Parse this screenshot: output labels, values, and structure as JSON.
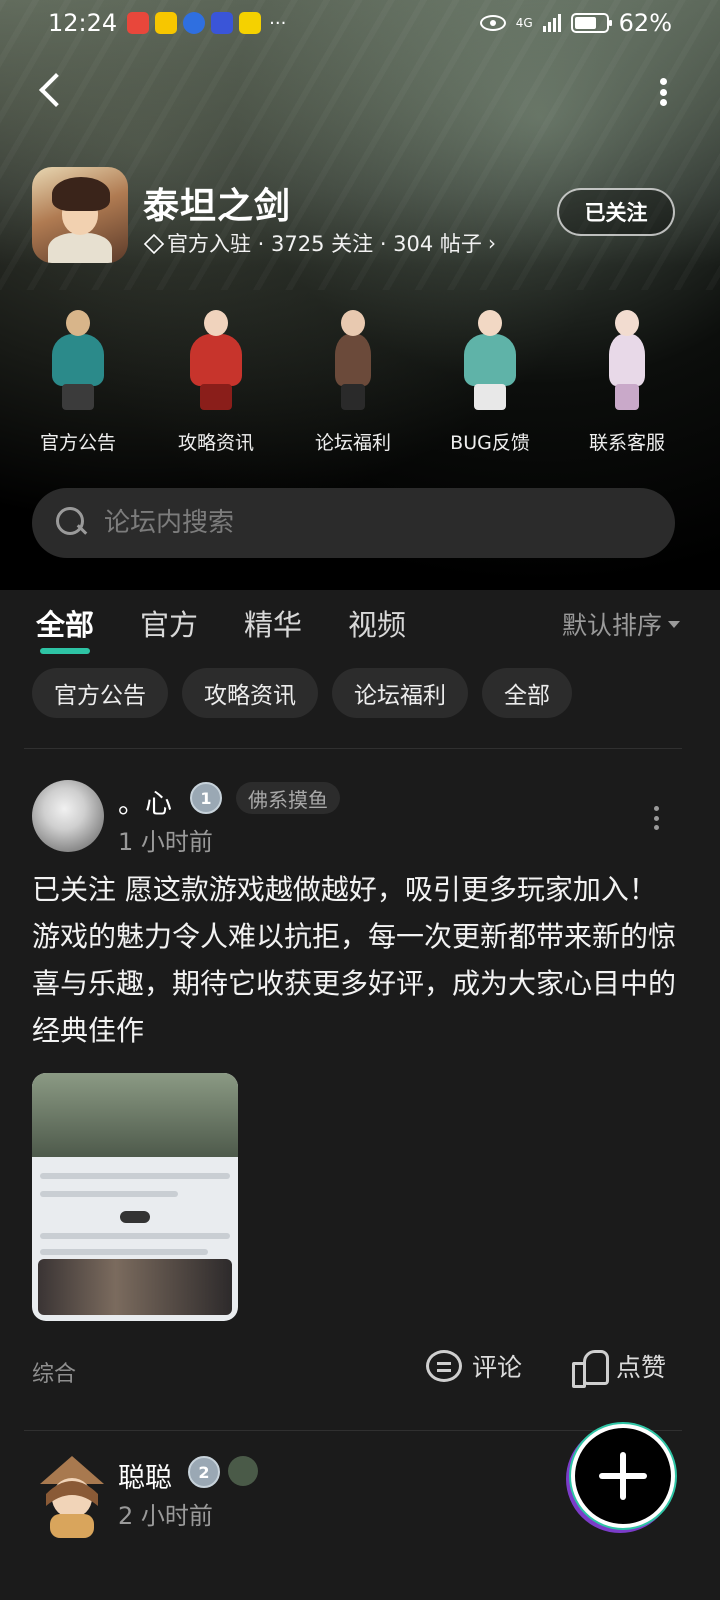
{
  "status_bar": {
    "time": "12:24",
    "more": "···",
    "network": "4G",
    "battery": "62%",
    "battery_level": 0.62,
    "app_icons": [
      {
        "name": "shopping-app-icon",
        "color": "#e8473b"
      },
      {
        "name": "meituan-app-icon",
        "color": "#f7c600"
      },
      {
        "name": "bulb-app-icon",
        "color": "#2f6fe0"
      },
      {
        "name": "tieba-app-icon",
        "color": "#3a55d8"
      },
      {
        "name": "yellow-app-icon",
        "color": "#f5d100"
      }
    ]
  },
  "game": {
    "title": "泰坦之剑",
    "meta": "官方入驻 · 3725 关注 · 304 帖子",
    "follow_label": "已关注"
  },
  "shortcuts": [
    {
      "label": "官方公告",
      "colors": [
        "#2b8a8a",
        "#d8b58a",
        "#3b3b3b"
      ]
    },
    {
      "label": "攻略资讯",
      "colors": [
        "#111111",
        "#c7342c",
        "#8a1e1a"
      ]
    },
    {
      "label": "论坛福利",
      "colors": [
        "#1f1f2e",
        "#6b4a3a",
        "#2a2a2a"
      ]
    },
    {
      "label": "BUG反馈",
      "colors": [
        "#5a3e30",
        "#5fb3a8",
        "#e8e8e8"
      ]
    },
    {
      "label": "联系客服",
      "colors": [
        "#2a2230",
        "#e8d9e8",
        "#c9a9c9"
      ]
    }
  ],
  "search": {
    "placeholder": "论坛内搜索"
  },
  "tabs": [
    "全部",
    "官方",
    "精华",
    "视频"
  ],
  "active_tab": "全部",
  "sort_label": "默认排序",
  "chips": [
    "官方公告",
    "攻略资讯",
    "论坛福利",
    "全部"
  ],
  "posts": [
    {
      "username": "。心",
      "level": "1",
      "tag": "佛系摸鱼",
      "time": "1 小时前",
      "body": "已关注 愿这款游戏越做越好，吸引更多玩家加入！游戏的魅力令人难以抗拒，每一次更新都带来新的惊喜与乐趣，期待它收获更多好评，成为大家心目中的经典佳作",
      "category": "综合",
      "comment_label": "评论",
      "like_label": "点赞"
    },
    {
      "username": "聪聪",
      "level": "2",
      "time": "2 小时前"
    }
  ],
  "colors": {
    "accent": "#2ec4a5",
    "background": "#1b1b1b",
    "chip": "#2c2c2c"
  }
}
